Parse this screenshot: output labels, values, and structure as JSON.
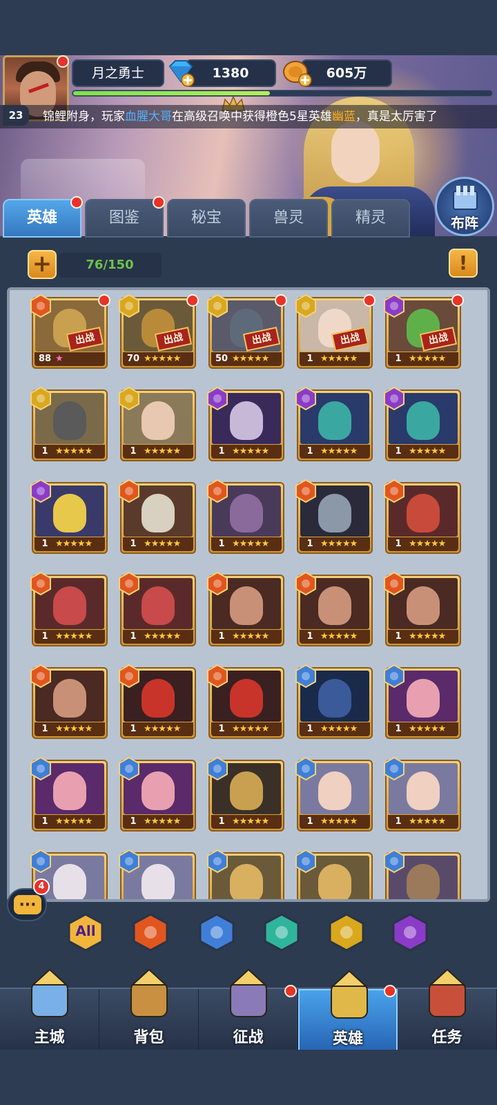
{
  "player": {
    "name": "月之勇士",
    "level": "23",
    "gems": "1380",
    "gold": "605万",
    "exp_progress": 0.47
  },
  "marquee": {
    "prefix": "锦鲤附身，玩家",
    "player": "血腥大哥",
    "middle": "在高级召唤中获得橙色5星英雄",
    "hero": "幽蓝",
    "suffix": "，真是太厉害了"
  },
  "tabs": [
    {
      "label": "英雄",
      "active": true,
      "badge": true
    },
    {
      "label": "图鉴",
      "active": false,
      "badge": true
    },
    {
      "label": "秘宝",
      "active": false,
      "badge": false
    },
    {
      "label": "兽灵",
      "active": false,
      "badge": false
    },
    {
      "label": "精灵",
      "active": false,
      "badge": false
    }
  ],
  "formation_label": "布阵",
  "capacity": "76/150",
  "deploy_label": "出战",
  "chat_count": "4",
  "factions": {
    "fire": "#e0561e",
    "light": "#d9a81e",
    "dark": "#8a3cc8",
    "water": "#3f7fd8",
    "nature": "#2fb59c"
  },
  "heroes": [
    {
      "level": "88",
      "stars": "★",
      "faction": "fire",
      "deployed": true,
      "badge": true,
      "bg": "#8a6a3a",
      "head": "#c9a050",
      "pink": true
    },
    {
      "level": "70",
      "stars": "★★★★★",
      "faction": "light",
      "deployed": true,
      "badge": true,
      "bg": "#6a5a3a",
      "head": "#b88a3a"
    },
    {
      "level": "50",
      "stars": "★★★★★",
      "faction": "light",
      "deployed": true,
      "badge": true,
      "bg": "#5a5a6a",
      "head": "#5d6a7a"
    },
    {
      "level": "1",
      "stars": "★★★★★",
      "faction": "light",
      "deployed": true,
      "badge": true,
      "bg": "#c9b8a8",
      "head": "#f0d8c8"
    },
    {
      "level": "1",
      "stars": "★★★★★",
      "faction": "dark",
      "deployed": true,
      "badge": true,
      "bg": "#6a4a3a",
      "head": "#5fb04a"
    },
    {
      "level": "1",
      "stars": "★★★★★",
      "faction": "light",
      "bg": "#7a6a4a",
      "head": "#5a5a5a"
    },
    {
      "level": "1",
      "stars": "★★★★★",
      "faction": "light",
      "bg": "#8a7a5a",
      "head": "#e8c8b0"
    },
    {
      "level": "1",
      "stars": "★★★★★",
      "faction": "dark",
      "bg": "#3a2a5a",
      "head": "#c8b8d8"
    },
    {
      "level": "1",
      "stars": "★★★★★",
      "faction": "dark",
      "bg": "#2a3a6a",
      "head": "#3aa8a0"
    },
    {
      "level": "1",
      "stars": "★★★★★",
      "faction": "dark",
      "bg": "#2a3a6a",
      "head": "#3aa8a0"
    },
    {
      "level": "1",
      "stars": "★★★★★",
      "faction": "dark",
      "bg": "#3a3a6a",
      "head": "#e8c84a"
    },
    {
      "level": "1",
      "stars": "★★★★★",
      "faction": "fire",
      "bg": "#5a3a2a",
      "head": "#d8d0c0"
    },
    {
      "level": "1",
      "stars": "★★★★★",
      "faction": "fire",
      "bg": "#4a3a5a",
      "head": "#8a6a9a"
    },
    {
      "level": "1",
      "stars": "★★★★★",
      "faction": "fire",
      "bg": "#2a2a3a",
      "head": "#8a98a8"
    },
    {
      "level": "1",
      "stars": "★★★★★",
      "faction": "fire",
      "bg": "#5a2a2a",
      "head": "#c84a3a"
    },
    {
      "level": "1",
      "stars": "★★★★★",
      "faction": "fire",
      "bg": "#5a2a2a",
      "head": "#c84a4a"
    },
    {
      "level": "1",
      "stars": "★★★★★",
      "faction": "fire",
      "bg": "#5a2a2a",
      "head": "#c84a4a"
    },
    {
      "level": "1",
      "stars": "★★★★★",
      "faction": "fire",
      "bg": "#4a2a22",
      "head": "#c99078"
    },
    {
      "level": "1",
      "stars": "★★★★★",
      "faction": "fire",
      "bg": "#4a2a22",
      "head": "#c99078"
    },
    {
      "level": "1",
      "stars": "★★★★★",
      "faction": "fire",
      "bg": "#4a2a22",
      "head": "#c99078"
    },
    {
      "level": "1",
      "stars": "★★★★★",
      "faction": "fire",
      "bg": "#4a2a22",
      "head": "#c99078"
    },
    {
      "level": "1",
      "stars": "★★★★★",
      "faction": "fire",
      "bg": "#3a2020",
      "head": "#c8342a"
    },
    {
      "level": "1",
      "stars": "★★★★★",
      "faction": "fire",
      "bg": "#3a2020",
      "head": "#c8342a"
    },
    {
      "level": "1",
      "stars": "★★★★★",
      "faction": "water",
      "bg": "#1a2a4a",
      "head": "#3a5a9a"
    },
    {
      "level": "1",
      "stars": "★★★★★",
      "faction": "water",
      "bg": "#5a2a6a",
      "head": "#e8a0b0"
    },
    {
      "level": "1",
      "stars": "★★★★★",
      "faction": "water",
      "bg": "#5a2a6a",
      "head": "#e8a0b0"
    },
    {
      "level": "1",
      "stars": "★★★★★",
      "faction": "water",
      "bg": "#5a2a6a",
      "head": "#e8a0b0"
    },
    {
      "level": "1",
      "stars": "★★★★★",
      "faction": "water",
      "bg": "#3a3028",
      "head": "#c8a050"
    },
    {
      "level": "1",
      "stars": "★★★★★",
      "faction": "water",
      "bg": "#7a7aa0",
      "head": "#f0d0c0"
    },
    {
      "level": "1",
      "stars": "★★★★★",
      "faction": "water",
      "bg": "#7a7aa0",
      "head": "#f0d0c0"
    },
    {
      "level": "",
      "stars": "",
      "faction": "water",
      "bg": "#7a7aa0",
      "head": "#e8e0e8"
    },
    {
      "level": "",
      "stars": "",
      "faction": "water",
      "bg": "#7a7aa0",
      "head": "#e8e0e8"
    },
    {
      "level": "",
      "stars": "",
      "faction": "water",
      "bg": "#6a5a3a",
      "head": "#d8b060"
    },
    {
      "level": "",
      "stars": "",
      "faction": "water",
      "bg": "#6a5a3a",
      "head": "#d8b060"
    },
    {
      "level": "",
      "stars": "",
      "faction": "water",
      "bg": "#5a4a6a",
      "head": "#9a7a5a"
    }
  ],
  "filters": [
    {
      "name": "all",
      "label": "All",
      "color": "#f2b53c"
    },
    {
      "name": "fire",
      "label": "",
      "color": "#e0561e"
    },
    {
      "name": "water",
      "label": "",
      "color": "#3f7fd8"
    },
    {
      "name": "nature",
      "label": "",
      "color": "#2fb59c"
    },
    {
      "name": "light",
      "label": "",
      "color": "#d9a81e"
    },
    {
      "name": "dark",
      "label": "",
      "color": "#8a3cc8"
    }
  ],
  "nav": [
    {
      "label": "主城",
      "icon": "castle-icon",
      "active": false,
      "badge": false
    },
    {
      "label": "背包",
      "icon": "chest-icon",
      "active": false,
      "badge": false
    },
    {
      "label": "征战",
      "icon": "swords-icon",
      "active": false,
      "badge": true
    },
    {
      "label": "英雄",
      "icon": "helmet-icon",
      "active": true,
      "badge": true
    },
    {
      "label": "任务",
      "icon": "scroll-icon",
      "active": false,
      "badge": false
    }
  ]
}
